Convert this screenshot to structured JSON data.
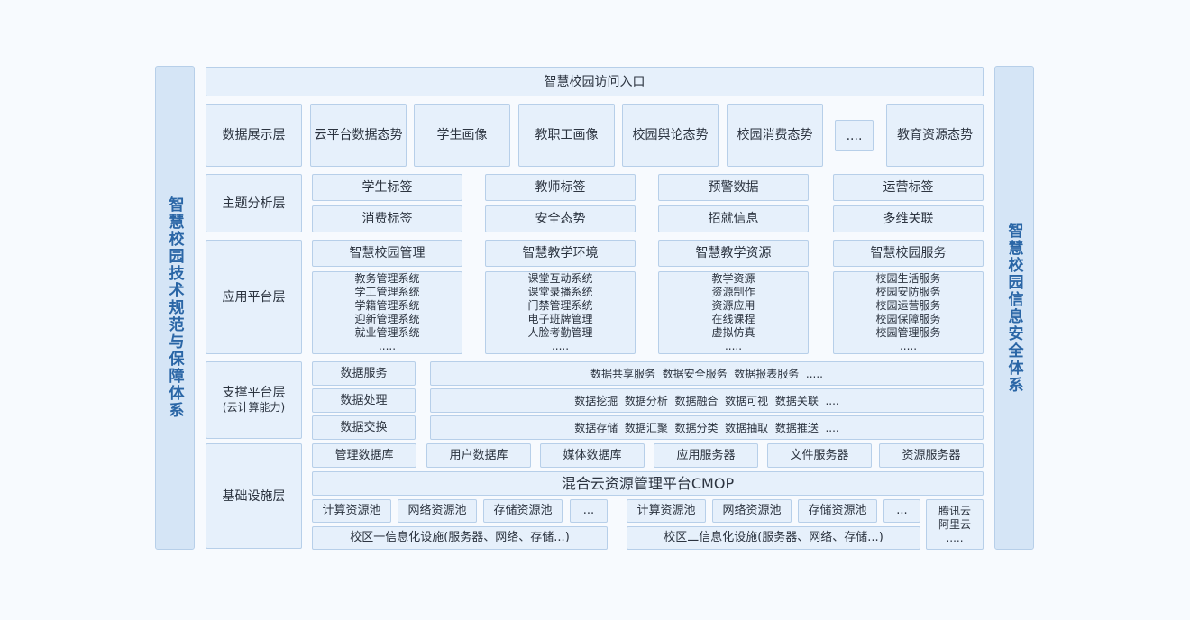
{
  "side_left": "智慧校园技术规范与保障体系",
  "side_right": "智慧校园信息安全体系",
  "entry": "智慧校园访问入口",
  "layers": {
    "display": "数据展示层",
    "analysis": "主题分析层",
    "app": "应用平台层",
    "support": "支撑平台层",
    "support_sub": "(云计算能力)",
    "infra": "基础设施层"
  },
  "display_items": [
    "云平台数据态势",
    "学生画像",
    "教职工画像",
    "校园舆论态势",
    "校园消费态势",
    "....",
    "教育资源态势"
  ],
  "analysis_items": [
    "学生标签",
    "教师标签",
    "预警数据",
    "运营标签",
    "消费标签",
    "安全态势",
    "招就信息",
    "多维关联"
  ],
  "app_titles": [
    "智慧校园管理",
    "智慧教学环境",
    "智慧教学资源",
    "智慧校园服务"
  ],
  "app_lists": [
    "教务管理系统\n学工管理系统\n学籍管理系统\n迎新管理系统\n就业管理系统\n.....",
    "课堂互动系统\n课堂录播系统\n门禁管理系统\n电子班牌管理\n人脸考勤管理\n.....",
    "教学资源\n资源制作\n资源应用\n在线课程\n虚拟仿真\n.....",
    "校园生活服务\n校园安防服务\n校园运营服务\n校园保障服务\n校园管理服务\n....."
  ],
  "support_left": [
    "数据服务",
    "数据处理",
    "数据交换"
  ],
  "support_right": [
    "数据共享服务  数据安全服务  数据报表服务  .....",
    "数据挖掘  数据分析  数据融合  数据可视  数据关联  ....",
    "数据存储  数据汇聚  数据分类  数据抽取  数据推送  ...."
  ],
  "infra_db": [
    "管理数据库",
    "用户数据库",
    "媒体数据库",
    "应用服务器",
    "文件服务器",
    "资源服务器"
  ],
  "cmop": "混合云资源管理平台CMOP",
  "pools_a": [
    "计算资源池",
    "网络资源池",
    "存储资源池",
    "..."
  ],
  "pools_b": [
    "计算资源池",
    "网络资源池",
    "存储资源池",
    "..."
  ],
  "campus_a": "校区一信息化设施(服务器、网络、存储...)",
  "campus_b": "校区二信息化设施(服务器、网络、存储...)",
  "cloud": "腾讯云\n阿里云\n....."
}
